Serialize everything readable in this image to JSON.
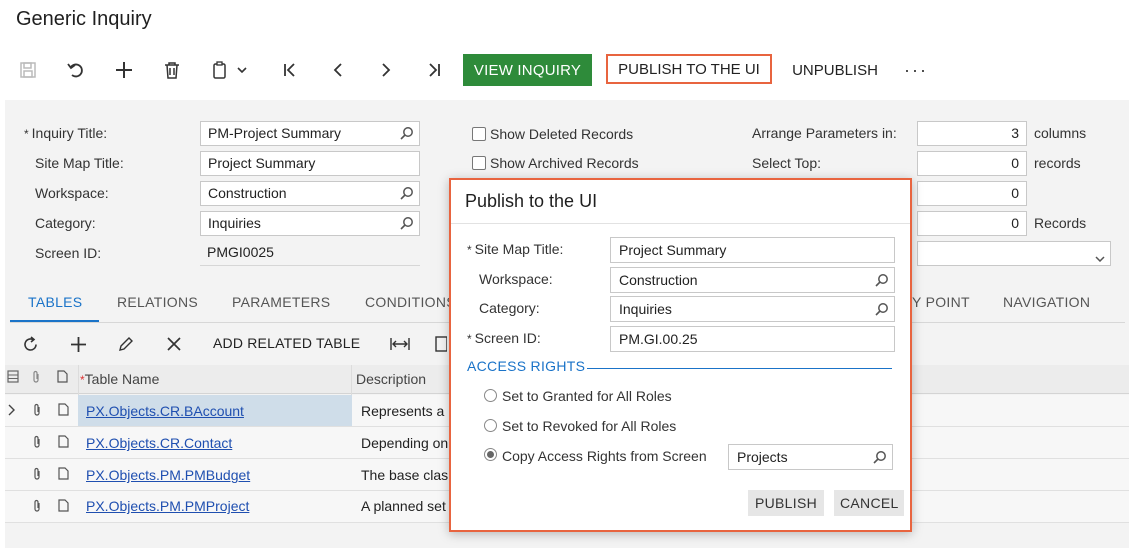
{
  "page": {
    "title": "Generic Inquiry"
  },
  "toolbar": {
    "view_inquiry": "VIEW INQUIRY",
    "publish_to_ui": "PUBLISH TO THE UI",
    "unpublish": "UNPUBLISH",
    "more": "···"
  },
  "form": {
    "inquiry_title": {
      "label": "Inquiry Title:",
      "value": "PM-Project Summary"
    },
    "site_map_title": {
      "label": "Site Map Title:",
      "value": "Project Summary"
    },
    "workspace": {
      "label": "Workspace:",
      "value": "Construction"
    },
    "category": {
      "label": "Category:",
      "value": "Inquiries"
    },
    "screen_id": {
      "label": "Screen ID:",
      "value": "PMGI0025"
    },
    "show_deleted": {
      "label": "Show Deleted Records"
    },
    "show_archived": {
      "label": "Show Archived Records"
    },
    "arrange_params": {
      "label": "Arrange Parameters in:",
      "value": "3",
      "unit": "columns"
    },
    "select_top": {
      "label": "Select Top:",
      "value": "0",
      "unit": "records"
    },
    "field3": {
      "value": "0"
    },
    "field4": {
      "value": "0",
      "unit": "Records"
    }
  },
  "tabs": [
    {
      "label": "TABLES"
    },
    {
      "label": "RELATIONS"
    },
    {
      "label": "PARAMETERS"
    },
    {
      "label": "CONDITIONS"
    },
    {
      "label": "Y POINT"
    },
    {
      "label": "NAVIGATION"
    }
  ],
  "grid": {
    "add_related_table": "ADD RELATED TABLE",
    "headers": {
      "table_name": "Table Name",
      "description": "Description"
    },
    "rows": [
      {
        "table": "PX.Objects.CR.BAccount",
        "desc": "Represents a"
      },
      {
        "table": "PX.Objects.CR.Contact",
        "desc": "Depending on"
      },
      {
        "table": "PX.Objects.PM.PMBudget",
        "desc": "The base clas"
      },
      {
        "table": "PX.Objects.PM.PMProject",
        "desc": "A planned set"
      }
    ]
  },
  "dialog": {
    "title": "Publish to the UI",
    "site_map_title": {
      "label": "Site Map Title:",
      "value": "Project Summary"
    },
    "workspace": {
      "label": "Workspace:",
      "value": "Construction"
    },
    "category": {
      "label": "Category:",
      "value": "Inquiries"
    },
    "screen_id": {
      "label": "Screen ID:",
      "value": "PM.GI.00.25"
    },
    "access_rights": {
      "section": "ACCESS RIGHTS",
      "opt_granted": "Set to Granted for All Roles",
      "opt_revoked": "Set to Revoked for All Roles",
      "opt_copy": "Copy Access Rights from Screen",
      "copy_screen": "Projects",
      "selected": "copy"
    },
    "publish": "PUBLISH",
    "cancel": "CANCEL"
  },
  "colors": {
    "accent": "#1a73c8",
    "success": "#2e8b3a",
    "highlight": "#e8643f"
  }
}
